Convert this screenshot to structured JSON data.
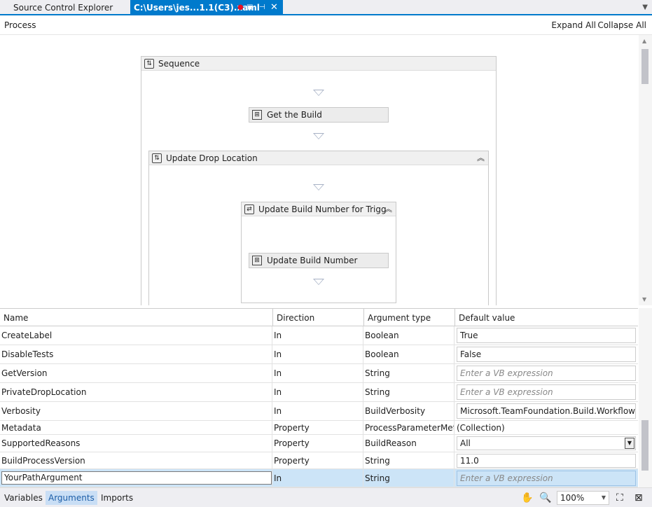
{
  "tabs": {
    "inactive_label": "Source Control Explorer",
    "active_label": "C:\\Users\\jes...1.1(C3).xaml",
    "active_icons": [
      "modified-dot-icon",
      "lock-icon",
      "pin-icon",
      "close-icon"
    ],
    "menu_icon": "dropdown-arrow-icon"
  },
  "designer_bar": {
    "breadcrumb": "Process",
    "expand_all": "Expand All",
    "collapse_all": "Collapse All"
  },
  "workflow": {
    "sequence": "Sequence",
    "get_build": "Get the Build",
    "update_drop": "Update Drop Location",
    "update_build_number_for": "Update Build Number for Trigg",
    "update_build_number": "Update Build Number"
  },
  "grid": {
    "headers": [
      "Name",
      "Direction",
      "Argument type",
      "Default value"
    ],
    "rows": [
      {
        "name": "CreateLabel",
        "direction": "In",
        "type": "Boolean",
        "value": "True"
      },
      {
        "name": "DisableTests",
        "direction": "In",
        "type": "Boolean",
        "value": "False"
      },
      {
        "name": "GetVersion",
        "direction": "In",
        "type": "String",
        "value": "Enter a VB expression"
      },
      {
        "name": "PrivateDropLocation",
        "direction": "In",
        "type": "String",
        "value": "Enter a VB expression"
      },
      {
        "name": "Verbosity",
        "direction": "In",
        "type": "BuildVerbosity",
        "value": "Microsoft.TeamFoundation.Build.Workflow.Bui"
      },
      {
        "name": "Metadata",
        "direction": "Property",
        "type": "ProcessParameterMetad",
        "value": "(Collection)"
      },
      {
        "name": "SupportedReasons",
        "direction": "Property",
        "type": "BuildReason",
        "value": "All"
      },
      {
        "name": "BuildProcessVersion",
        "direction": "Property",
        "type": "String",
        "value": "11.0"
      },
      {
        "name": "YourPathArgument",
        "direction": "In",
        "type": "String",
        "value": "Enter a VB expression"
      }
    ]
  },
  "bottom": {
    "variables": "Variables",
    "arguments": "Arguments",
    "imports": "Imports",
    "zoom": "100%"
  },
  "colors": {
    "accent": "#007acc",
    "selection": "#cce4f7"
  }
}
